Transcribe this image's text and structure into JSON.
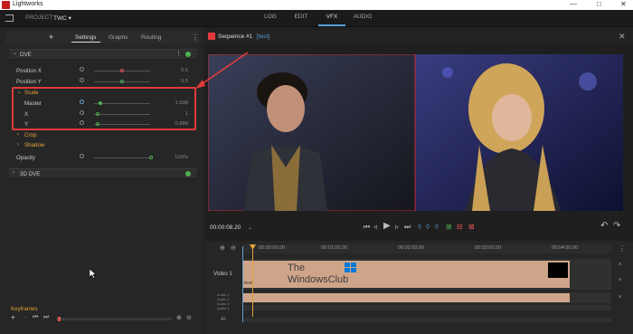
{
  "app": {
    "title": "Lightworks",
    "project_label": "PROJECT",
    "project_name": "TWC ▾"
  },
  "window_controls": {
    "minimize": "—",
    "maximize": "□",
    "close": "✕"
  },
  "main_tabs": [
    "LOG",
    "EDIT",
    "VFX",
    "AUDIO"
  ],
  "left_panel": {
    "add": "+",
    "tabs": [
      "Settings",
      "Graphs",
      "Routing"
    ],
    "more": "⋮",
    "dve": {
      "title": "DVE",
      "rows": [
        {
          "label": "Position X",
          "value": "0.5"
        },
        {
          "label": "Position Y",
          "value": "0.5"
        }
      ],
      "scale": {
        "title": "Scale",
        "rows": [
          {
            "label": "Master",
            "value": "1.538"
          },
          {
            "label": "X",
            "value": "1"
          },
          {
            "label": "Y",
            "value": "0.999"
          }
        ]
      },
      "crop": "Crop",
      "shadow": "Shadow",
      "opacity": {
        "label": "Opacity",
        "value": "100%"
      }
    },
    "dve3d": {
      "title": "3D DVE"
    },
    "keyframes": {
      "title": "Keyframes"
    }
  },
  "viewer": {
    "sequence": "Sequence #1",
    "tag": "[test]",
    "timecode": "00:00:08.20"
  },
  "timeline": {
    "ruler": [
      "00:00:00.00",
      "00:01:00.00",
      "00:02:00.00",
      "00:03:00.00",
      "00:04:00.00"
    ],
    "tracks": {
      "video": "Video 1",
      "audio": [
        "Audio 1",
        "Audio 2",
        "Audio 3",
        "Audio 4"
      ],
      "all": "All"
    },
    "clip_label": "test"
  },
  "watermark": {
    "line1": "The",
    "line2": "WindowsClub"
  },
  "colors": {
    "accent_blue": "#5aa0d8",
    "highlight_red": "#e23a3a",
    "scale_orange": "#e0a23a",
    "clip": "#cfa58a",
    "green": "#4fb04f"
  }
}
